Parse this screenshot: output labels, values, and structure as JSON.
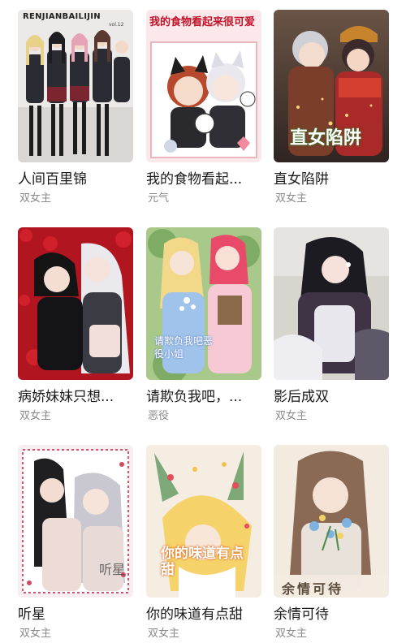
{
  "comics": [
    {
      "title": "人间百里锦",
      "tag": "双女主",
      "cover_text": "RENJIANBAILIJIN",
      "cover_sub": "vol.12"
    },
    {
      "title": "我的食物看起...",
      "tag": "元气",
      "cover_text": "我的食物看起来很可爱"
    },
    {
      "title": "直女陷阱",
      "tag": "双女主",
      "cover_text": "直女陷阱"
    },
    {
      "title": "病娇妹妹只想...",
      "tag": "双女主"
    },
    {
      "title": "请欺负我吧，...",
      "tag": "恶役",
      "cover_text": "请欺负我吧恶役小姐"
    },
    {
      "title": "影后成双",
      "tag": "双女主"
    },
    {
      "title": "听星",
      "tag": "双女主",
      "cover_text": "听星"
    },
    {
      "title": "你的味道有点甜",
      "tag": "双女主",
      "cover_text": "你的味道有点甜"
    },
    {
      "title": "余情可待",
      "tag": "双女主",
      "cover_text": "余情可待"
    }
  ]
}
